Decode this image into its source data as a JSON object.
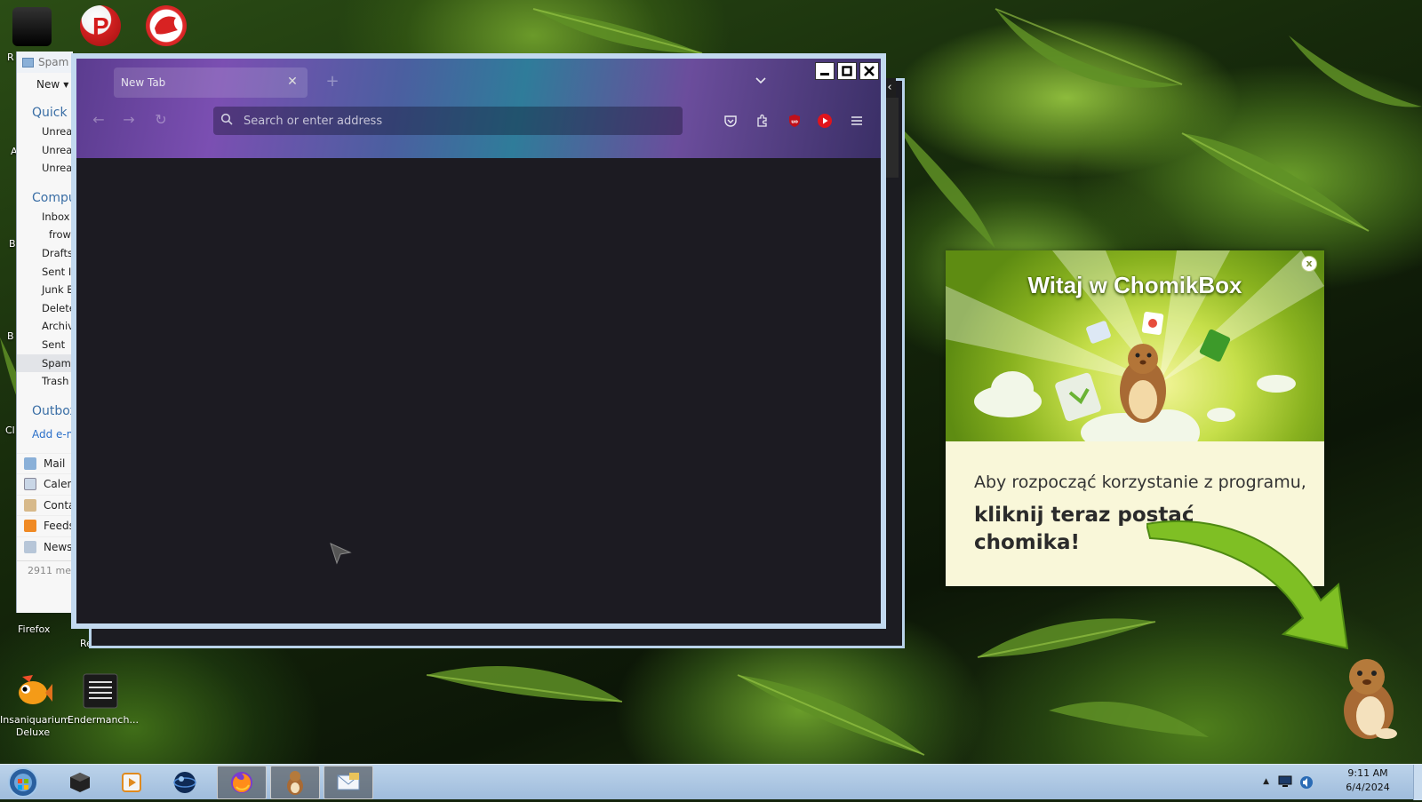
{
  "desktop": {
    "icons": [
      {
        "label": "Insaniquarium Deluxe"
      },
      {
        "label": "Endermanch..."
      },
      {
        "label": "Firefox"
      }
    ],
    "edge_letters": [
      "R",
      "A",
      "B",
      "B",
      "Cl",
      "Re"
    ]
  },
  "thunderbird": {
    "title": "Spam",
    "new_label": "New",
    "sections": [
      {
        "title": "Quick v",
        "items": [
          "Unread",
          "Unread",
          "Unread"
        ]
      },
      {
        "title": "Compu",
        "items": [
          "Inbox",
          "frow",
          "Drafts",
          "Sent It",
          "Junk E",
          "Delete",
          "Archiv",
          "Sent",
          "Spam",
          "Trash"
        ]
      },
      {
        "title": "Outbox",
        "items": []
      }
    ],
    "add_link": "Add e-m",
    "nav": [
      "Mail",
      "Calen",
      "Conta",
      "Feeds",
      "News"
    ],
    "status": "2911 mes"
  },
  "firefox": {
    "tab_title": "New Tab",
    "url_placeholder": "Search or enter address",
    "colors": {
      "frame": "#c2d9ef",
      "content": "#1c1b22",
      "accent": "#7b4fb2"
    }
  },
  "chomikbox": {
    "title": "Witaj w ChomikBox",
    "close": "x",
    "line1": "Aby rozpocząć korzystanie z programu,",
    "line2": "kliknij teraz postać chomika!"
  },
  "taskbar": {
    "time": "9:11 AM",
    "date": "6/4/2024"
  }
}
